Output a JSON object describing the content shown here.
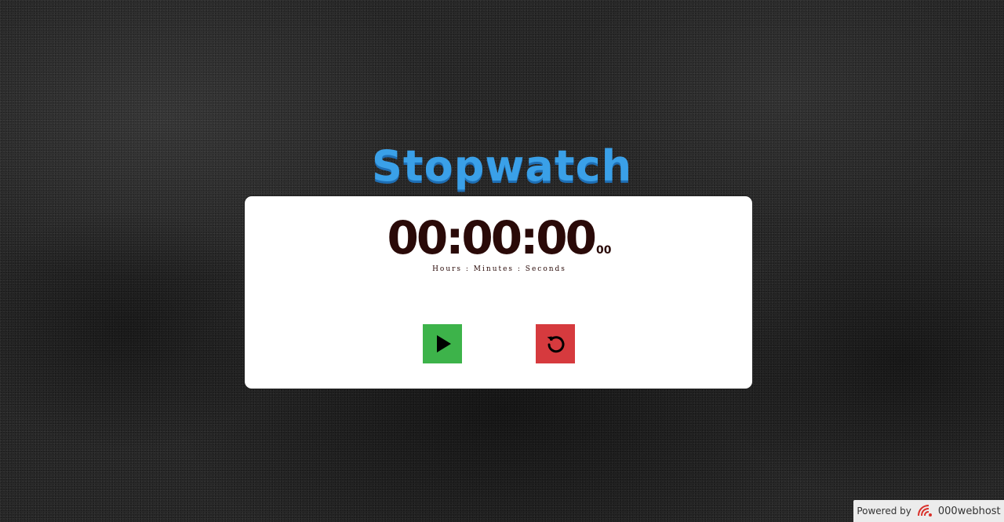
{
  "app": {
    "title": "Stopwatch"
  },
  "stopwatch": {
    "time": "00:00:00",
    "milliseconds": "00",
    "caption": "Hours : Minutes : Seconds"
  },
  "controls": {
    "start_icon": "play-icon",
    "reset_icon": "reset-icon",
    "start_color": "#3db34a",
    "reset_color": "#d63a3e"
  },
  "footer": {
    "powered_label": "Powered by",
    "brand": "000webhost",
    "brand_icon": "000webhost-logo-icon"
  },
  "colors": {
    "title": "#3aa0e8",
    "digits": "#2a0a08",
    "card": "#ffffff"
  }
}
